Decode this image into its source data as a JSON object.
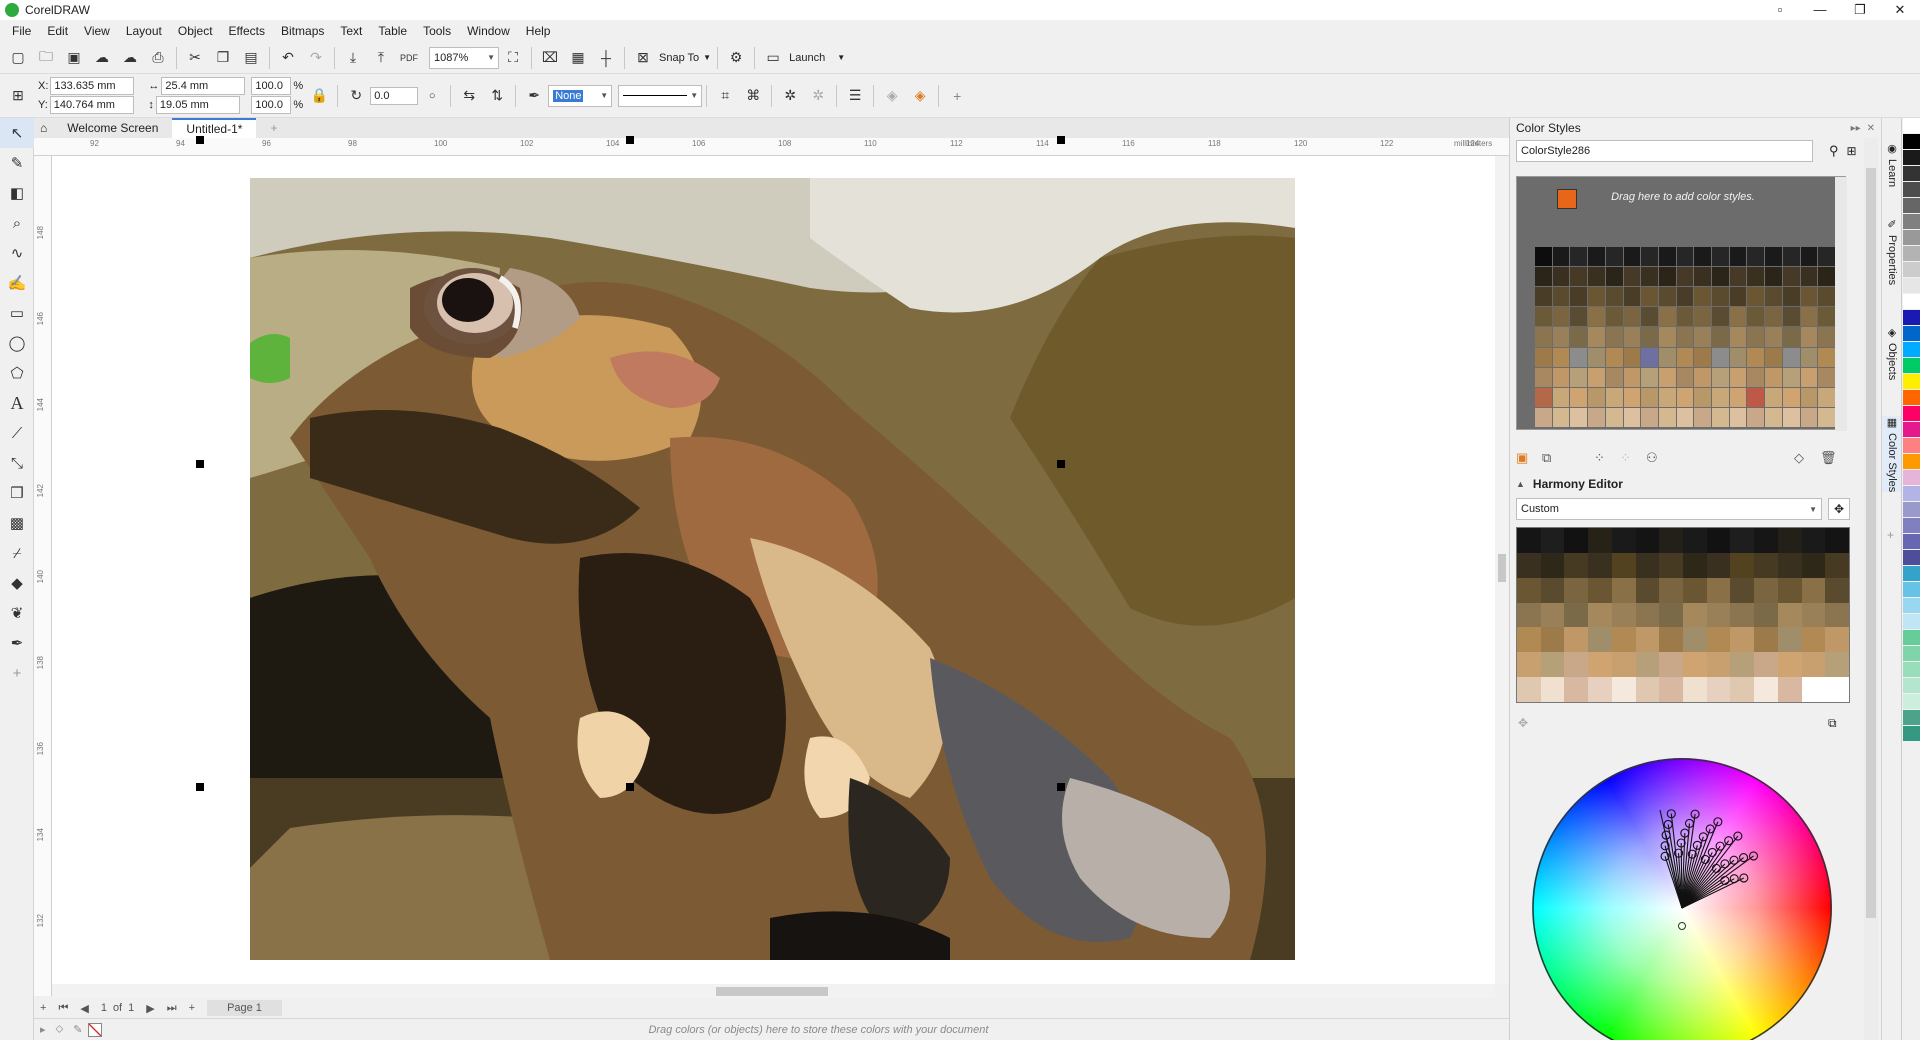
{
  "app": {
    "title": "CorelDRAW",
    "window_controls": [
      "▫",
      "—",
      "❐",
      "✕"
    ]
  },
  "menu": [
    "File",
    "Edit",
    "View",
    "Layout",
    "Object",
    "Effects",
    "Bitmaps",
    "Text",
    "Table",
    "Tools",
    "Window",
    "Help"
  ],
  "toolbar1": {
    "zoom": "1087%",
    "snap_to": "Snap To",
    "launch": "Launch",
    "pdf_label": "PDF"
  },
  "toolbar2": {
    "x_label": "X:",
    "x_value": "133.635 mm",
    "y_label": "Y:",
    "y_value": "140.764 mm",
    "w_value": "25.4 mm",
    "h_value": "19.05 mm",
    "scale_x": "100.0",
    "scale_y": "100.0",
    "percent": "%",
    "rotation": "0.0",
    "outline_width": "None"
  },
  "tabs": {
    "welcome": "Welcome Screen",
    "document": "Untitled-1*",
    "add": "+"
  },
  "ruler": {
    "h_ticks": [
      "92",
      "94",
      "96",
      "98",
      "100",
      "102",
      "104",
      "106",
      "108",
      "110",
      "112",
      "114",
      "116",
      "118",
      "120",
      "122",
      "124"
    ],
    "unit": "millimeters",
    "v_ticks": [
      "148",
      "146",
      "144",
      "142",
      "140",
      "138",
      "136",
      "134",
      "132"
    ]
  },
  "page_nav": {
    "page_count": "1",
    "of_label": "of",
    "total": "1",
    "page_tab": "Page 1"
  },
  "status": {
    "hint": "Drag colors (or objects) here to store these colors with your document"
  },
  "docker": {
    "title": "Color Styles",
    "style_name": "ColorStyle286",
    "drop_hint": "Drag here to add color styles.",
    "harmony_title": "Harmony Editor",
    "harmony_mode": "Custom"
  },
  "vertical_tabs": [
    "Learn",
    "Properties",
    "Objects",
    "Color Styles"
  ],
  "colors": {
    "accent": "#3a7bd5",
    "style_chip": "#e8661a"
  },
  "palette": [
    "#ffffff",
    "#000000",
    "#1a1a1a",
    "#333333",
    "#4d4d4d",
    "#666666",
    "#808080",
    "#999999",
    "#b3b3b3",
    "#cccccc",
    "#e6e6e6",
    "#ffffff",
    "#1a1ab3",
    "#0066cc",
    "#00aaff",
    "#00cc66",
    "#ffee00",
    "#ff6600",
    "#ff0066",
    "#e6198c",
    "#ff8080",
    "#ff9900",
    "#e6b3d9",
    "#b3b3e6",
    "#9999cc",
    "#8080c0",
    "#6666b3",
    "#4d4d99",
    "#33a3cc",
    "#66c2e6",
    "#99d6f0",
    "#c0e6f5",
    "#66cc99",
    "#80d4aa",
    "#99ddbb",
    "#b3e6cc",
    "#cceedd",
    "#4da38a",
    "#339980"
  ],
  "swatch_rows": [
    [
      "#0d0d0d",
      "#1a1a1a",
      "#262626",
      "#1a1a1a",
      "#262626",
      "#1a1a1a",
      "#262626",
      "#1a1a1a",
      "#262626",
      "#1a1a1a",
      "#262626",
      "#1a1a1a",
      "#262626",
      "#1a1a1a",
      "#262626",
      "#1a1a1a",
      "#262626"
    ],
    [
      "#2b2418",
      "#3a3020",
      "#463a26",
      "#3a3020",
      "#2b2418",
      "#463a26",
      "#3a3020",
      "#2b2418",
      "#463a26",
      "#3a3020",
      "#2b2418",
      "#463a26",
      "#3a3020",
      "#2b2418",
      "#463a26",
      "#3a3020",
      "#2b2418"
    ],
    [
      "#4a3d28",
      "#5a4a2e",
      "#4a3d28",
      "#6a5633",
      "#5a4a2e",
      "#4a3d28",
      "#6a5633",
      "#5a4a2e",
      "#4a3d28",
      "#6a5633",
      "#5a4a2e",
      "#4a3d28",
      "#6a5633",
      "#5a4a2e",
      "#4a3d28",
      "#6a5633",
      "#5a4a2e"
    ],
    [
      "#6b5a38",
      "#7a6540",
      "#5a4c32",
      "#8a7046",
      "#6b5a38",
      "#7a6540",
      "#5a4c32",
      "#8a7046",
      "#6b5a38",
      "#7a6540",
      "#5a4c32",
      "#8a7046",
      "#6b5a38",
      "#7a6540",
      "#5a4c32",
      "#8a7046",
      "#6b5a38"
    ],
    [
      "#8a7550",
      "#9a8058",
      "#7a6a48",
      "#a5885c",
      "#8a7550",
      "#9a8058",
      "#7a6a48",
      "#a5885c",
      "#8a7550",
      "#9a8058",
      "#7a6a48",
      "#a5885c",
      "#8a7550",
      "#9a8058",
      "#7a6a48",
      "#a5885c",
      "#8a7550"
    ],
    [
      "#9c7a4a",
      "#b08a52",
      "#8c8c8c",
      "#a08d6a",
      "#b08a52",
      "#9c7a4a",
      "#7070a0",
      "#a08d6a",
      "#b08a52",
      "#9c7a4a",
      "#8c8c8c",
      "#a08d6a",
      "#b08a52",
      "#9c7a4a",
      "#8c8c8c",
      "#a08d6a",
      "#b08a52"
    ],
    [
      "#a88860",
      "#c09868",
      "#b5a07a",
      "#c8a070",
      "#a88860",
      "#c09868",
      "#b5a07a",
      "#c8a070",
      "#a88860",
      "#c09868",
      "#b5a07a",
      "#c8a070",
      "#a88860",
      "#c09868",
      "#b5a07a",
      "#c8a070",
      "#a88860"
    ],
    [
      "#b46848",
      "#c8a878",
      "#d0a470",
      "#b89868",
      "#c8a878",
      "#d0a470",
      "#b89868",
      "#c8a878",
      "#d0a470",
      "#b89868",
      "#c8a878",
      "#d0a470",
      "#c05848",
      "#c8a878",
      "#d0a470",
      "#b89868",
      "#c8a878"
    ],
    [
      "#c8a888",
      "#d4b890",
      "#dcc0a0",
      "#c8a888",
      "#d4b890",
      "#dcc0a0",
      "#c8a888",
      "#d4b890",
      "#dcc0a0",
      "#c8a888",
      "#d4b890",
      "#dcc0a0",
      "#c8a888",
      "#d4b890",
      "#dcc0a0",
      "#c8a888",
      "#d4b890"
    ]
  ],
  "harmony_rows": [
    [
      "#151515",
      "#1e1e1e",
      "#121212",
      "#262218",
      "#1a1a1a",
      "#141414",
      "#222018",
      "#1a1a1a",
      "#121212",
      "#1e1e1e",
      "#161616",
      "#222018",
      "#1a1a1a",
      "#141414"
    ],
    [
      "#3a3020",
      "#2e2818",
      "#463a22",
      "#3a3020",
      "#52421f",
      "#3a3020",
      "#463a22",
      "#2e2818",
      "#3a3020",
      "#52421f",
      "#463a22",
      "#3a3020",
      "#2e2818",
      "#463a22"
    ],
    [
      "#6a5633",
      "#5a4a2e",
      "#7a6540",
      "#6a5633",
      "#8a7046",
      "#5a4a2e",
      "#7a6540",
      "#6a5633",
      "#8a7046",
      "#5a4a2e",
      "#7a6540",
      "#6a5633",
      "#8a7046",
      "#5a4a2e"
    ],
    [
      "#8a7550",
      "#9a8058",
      "#7a6a48",
      "#a5885c",
      "#9a8058",
      "#8a7550",
      "#7a6a48",
      "#a5885c",
      "#9a8058",
      "#8a7550",
      "#7a6a48",
      "#a5885c",
      "#9a8058",
      "#8a7550"
    ],
    [
      "#b08a52",
      "#9c7a4a",
      "#c09868",
      "#a08d6a",
      "#b08a52",
      "#c09868",
      "#9c7a4a",
      "#a08d6a",
      "#b08a52",
      "#c09868",
      "#9c7a4a",
      "#a08d6a",
      "#b08a52",
      "#c09868"
    ],
    [
      "#c8a070",
      "#b5a07a",
      "#c8a888",
      "#d0a470",
      "#c8a070",
      "#b5a07a",
      "#c8a888",
      "#d0a470",
      "#c8a070",
      "#b5a07a",
      "#c8a888",
      "#d0a470",
      "#c8a070",
      "#b5a07a"
    ],
    [
      "#e0c8b0",
      "#f0e0d0",
      "#d8b8a0",
      "#e8d0c0",
      "#f5e8dc",
      "#e0c8b0",
      "#d8b8a0",
      "#f0e0d0",
      "#e8d0c0",
      "#e0c8b0",
      "#f5e8dc",
      "#d8b8a0",
      "#ffffff",
      "#ffffff"
    ]
  ]
}
